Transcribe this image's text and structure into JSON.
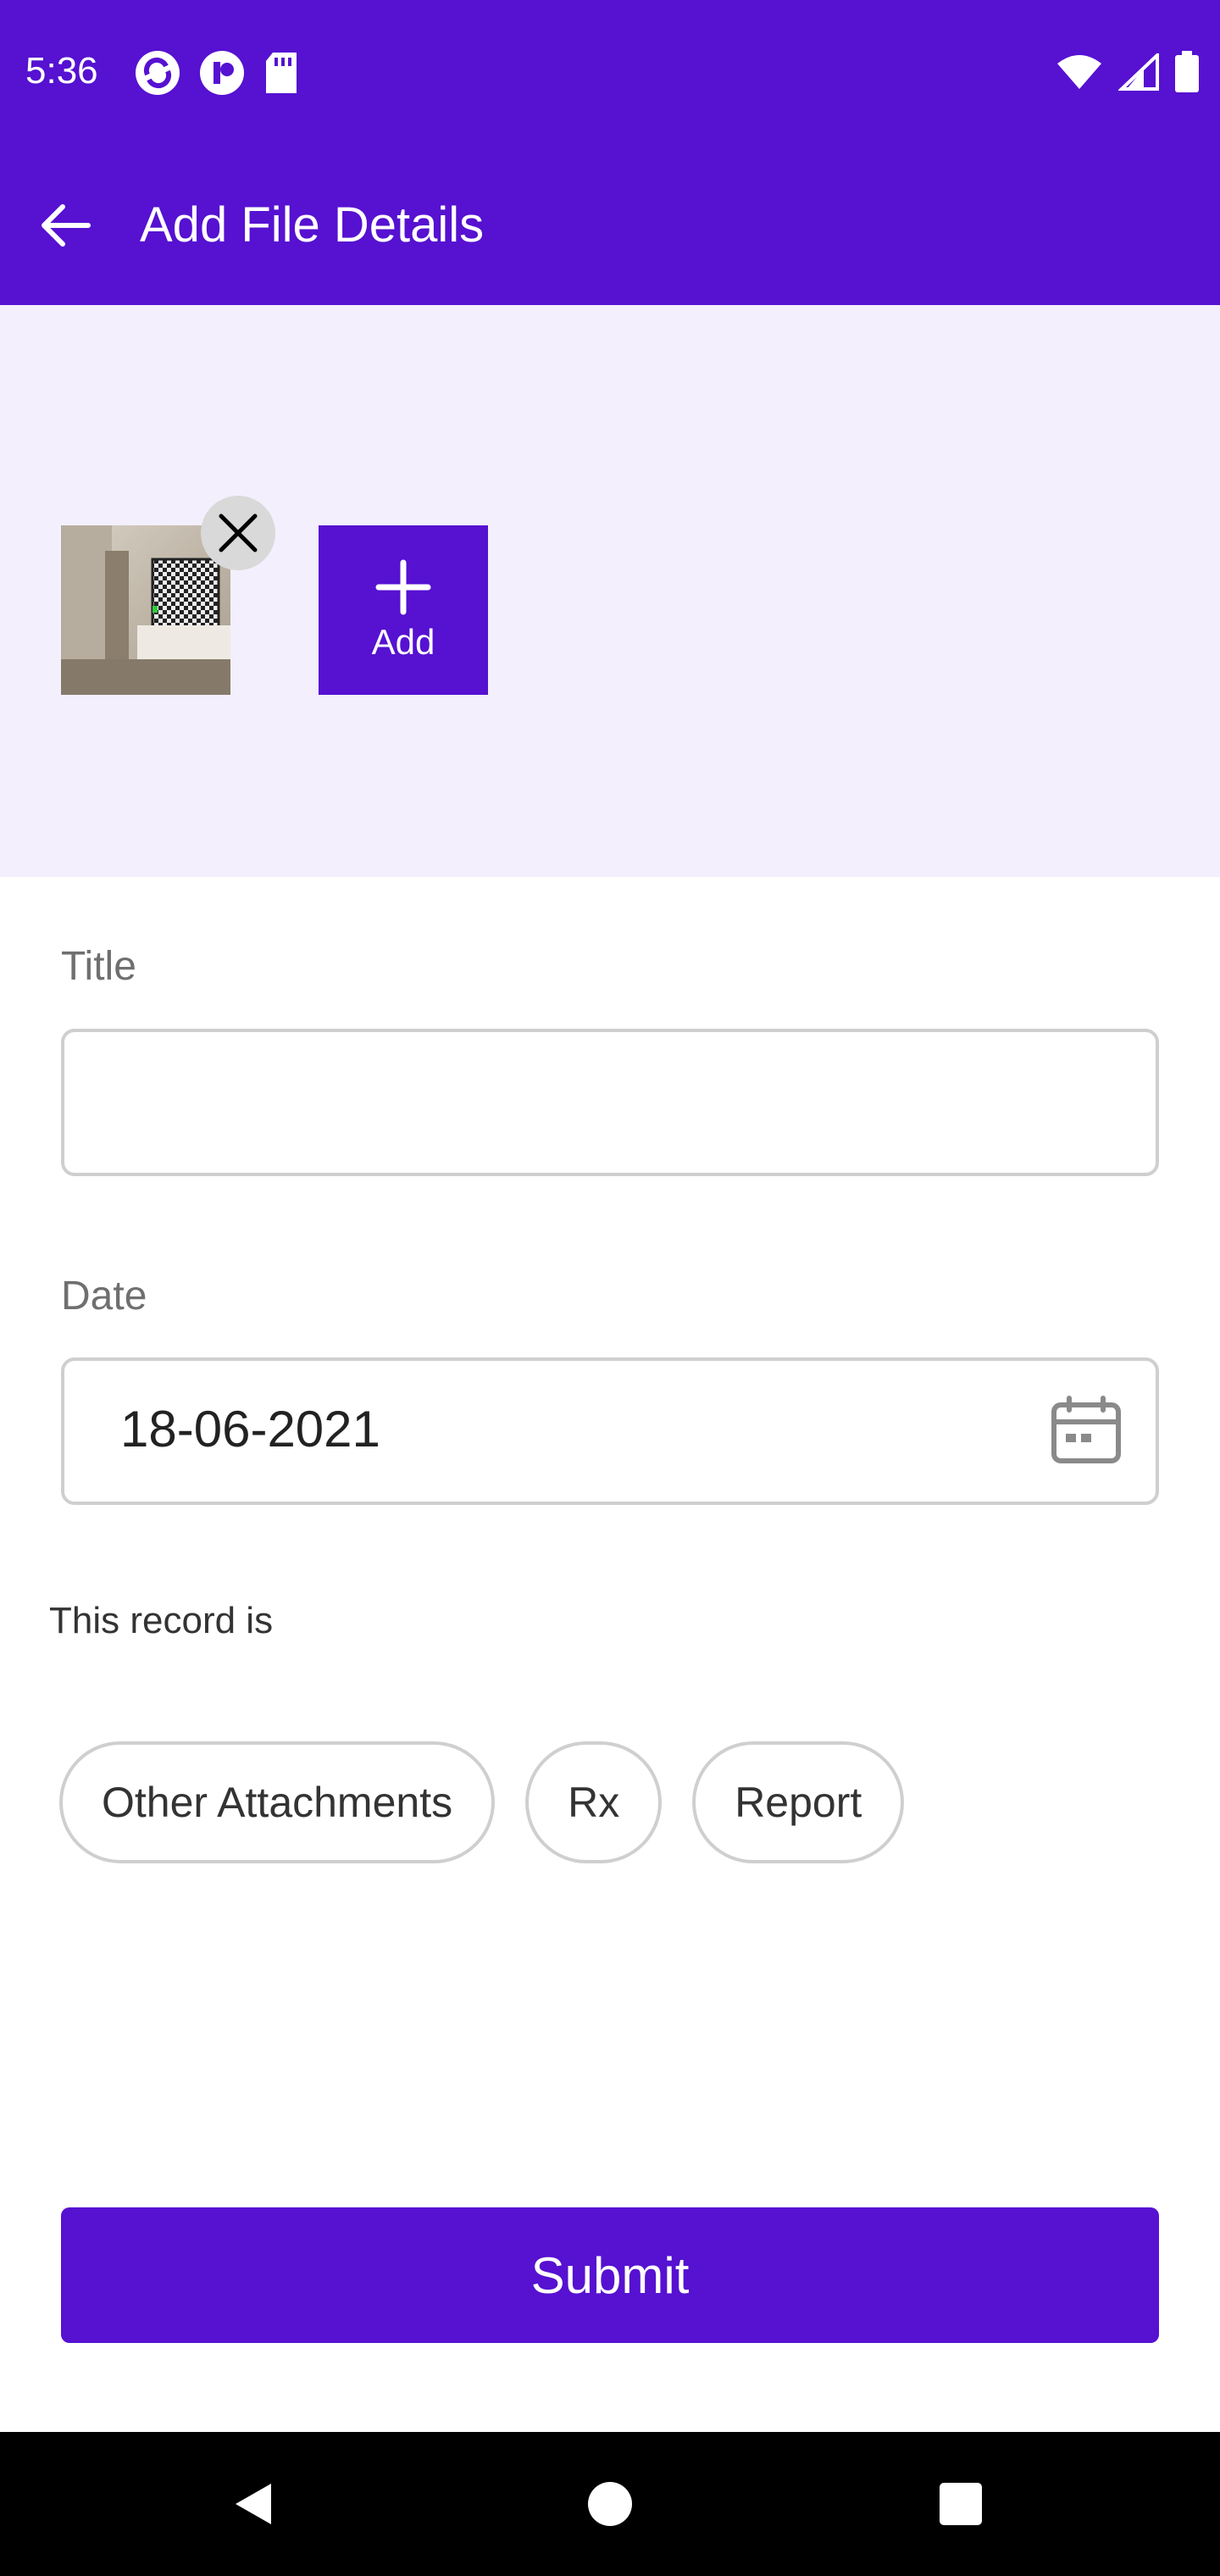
{
  "status_bar": {
    "time": "5:36",
    "left_icons": [
      "sync-icon",
      "tp-app-icon",
      "sd-card-icon"
    ],
    "right_icons": [
      "wifi-icon",
      "signal-icon",
      "battery-icon"
    ]
  },
  "app_bar": {
    "back_icon": "arrow-left-icon",
    "title": "Add File Details"
  },
  "attachments": {
    "thumbnail": "room-photo-thumbnail",
    "remove_icon": "close-icon",
    "add_label": "Add",
    "add_icon": "plus-icon"
  },
  "form": {
    "title_label": "Title",
    "title_value": "",
    "date_label": "Date",
    "date_value": "18-06-2021",
    "date_icon": "calendar-icon",
    "record_label": "This record is",
    "record_types": [
      "Other Attachments",
      "Rx",
      "Report"
    ]
  },
  "submit_label": "Submit",
  "nav_bar": [
    "back-triangle-icon",
    "home-circle-icon",
    "recents-square-icon"
  ],
  "colors": {
    "primary": "#5611D1",
    "attach_bg": "#F3EFFC",
    "border": "#cfcfcf"
  }
}
